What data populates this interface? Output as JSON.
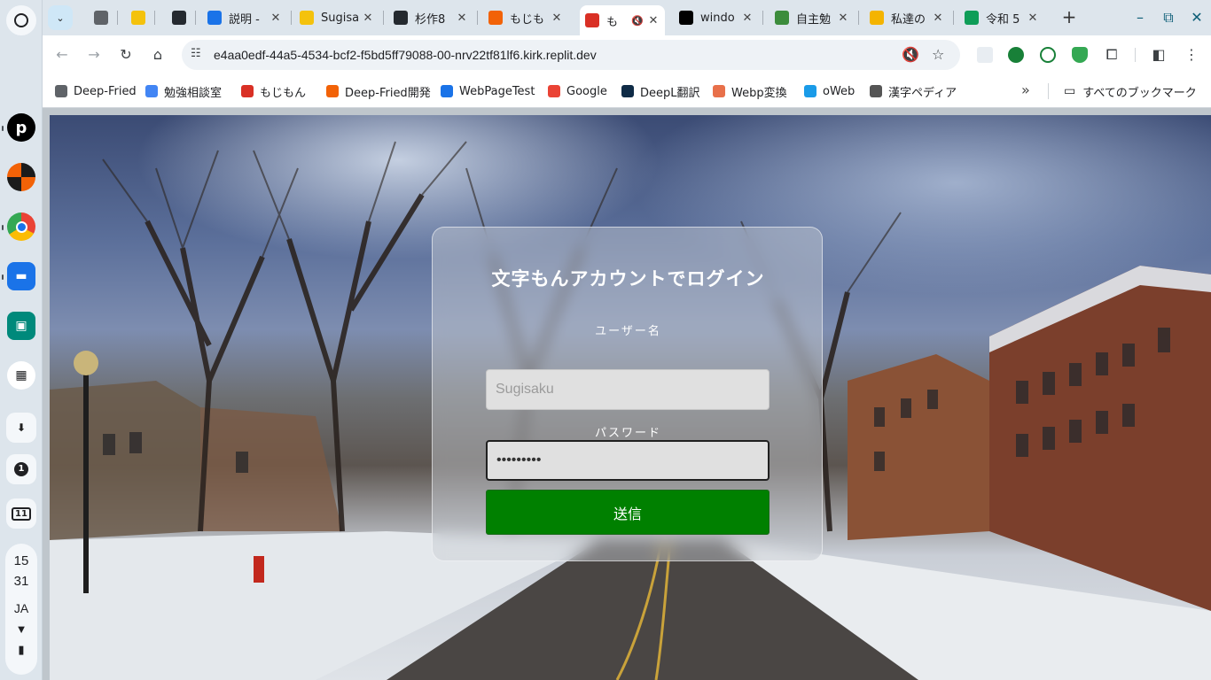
{
  "shelf": {
    "tray": {
      "badge": "1",
      "calendar_day": "11"
    },
    "status": {
      "hour": "15",
      "minute": "31",
      "ime": "JA"
    }
  },
  "tabs": [
    {
      "title": "",
      "icon": "globe-icon",
      "color": "#5f6368"
    },
    {
      "title": "",
      "icon": "emoji-icon",
      "color": "#f4c20d"
    },
    {
      "title": "",
      "icon": "github-icon",
      "color": "#24292f"
    },
    {
      "title": "説明 -",
      "icon": "c-icon",
      "color": "#1a73e8"
    },
    {
      "title": "Sugisa",
      "icon": "emoji-icon",
      "color": "#f4c20d"
    },
    {
      "title": "杉作8",
      "icon": "github-icon",
      "color": "#24292f"
    },
    {
      "title": "もじも",
      "icon": "replit-icon",
      "color": "#f26207"
    },
    {
      "title": "も",
      "icon": "mojimon-icon",
      "color": "#d93025",
      "active": true,
      "muted": true
    },
    {
      "title": "windo",
      "icon": "p-icon",
      "color": "#000000"
    },
    {
      "title": "自主勉",
      "icon": "image-icon",
      "color": "#3c8c3c"
    },
    {
      "title": "私達の",
      "icon": "slides-icon",
      "color": "#f4b400"
    },
    {
      "title": "令和 5",
      "icon": "sheets-icon",
      "color": "#0f9d58"
    }
  ],
  "toolbar": {
    "url": "e4aa0edf-44a5-4534-bcf2-f5bd5ff79088-00-nrv22tf81lf6.kirk.replit.dev"
  },
  "bookmarks": [
    {
      "label": "Deep-Fried",
      "color": "#5f6368"
    },
    {
      "label": "勉強相談室",
      "color": "#4285f4"
    },
    {
      "label": "もじもん",
      "color": "#d93025"
    },
    {
      "label": "Deep-Fried開発",
      "color": "#f26207"
    },
    {
      "label": "WebPageTest",
      "color": "#1a73e8"
    },
    {
      "label": "Google",
      "color": "#ea4335"
    },
    {
      "label": "DeepL翻訳",
      "color": "#0f2b46"
    },
    {
      "label": "Webp変換",
      "color": "#e8704a"
    },
    {
      "label": "oWeb",
      "color": "#1a9be8"
    },
    {
      "label": "漢字ペディア",
      "color": "#555555"
    }
  ],
  "all_bookmarks": "すべてのブックマーク",
  "login": {
    "title": "文字もんアカウントでログイン",
    "username_label": "ユーザー名",
    "username_placeholder": "Sugisaku",
    "password_label": "パスワード",
    "password_value": "sugisaku1",
    "submit": "送信"
  }
}
